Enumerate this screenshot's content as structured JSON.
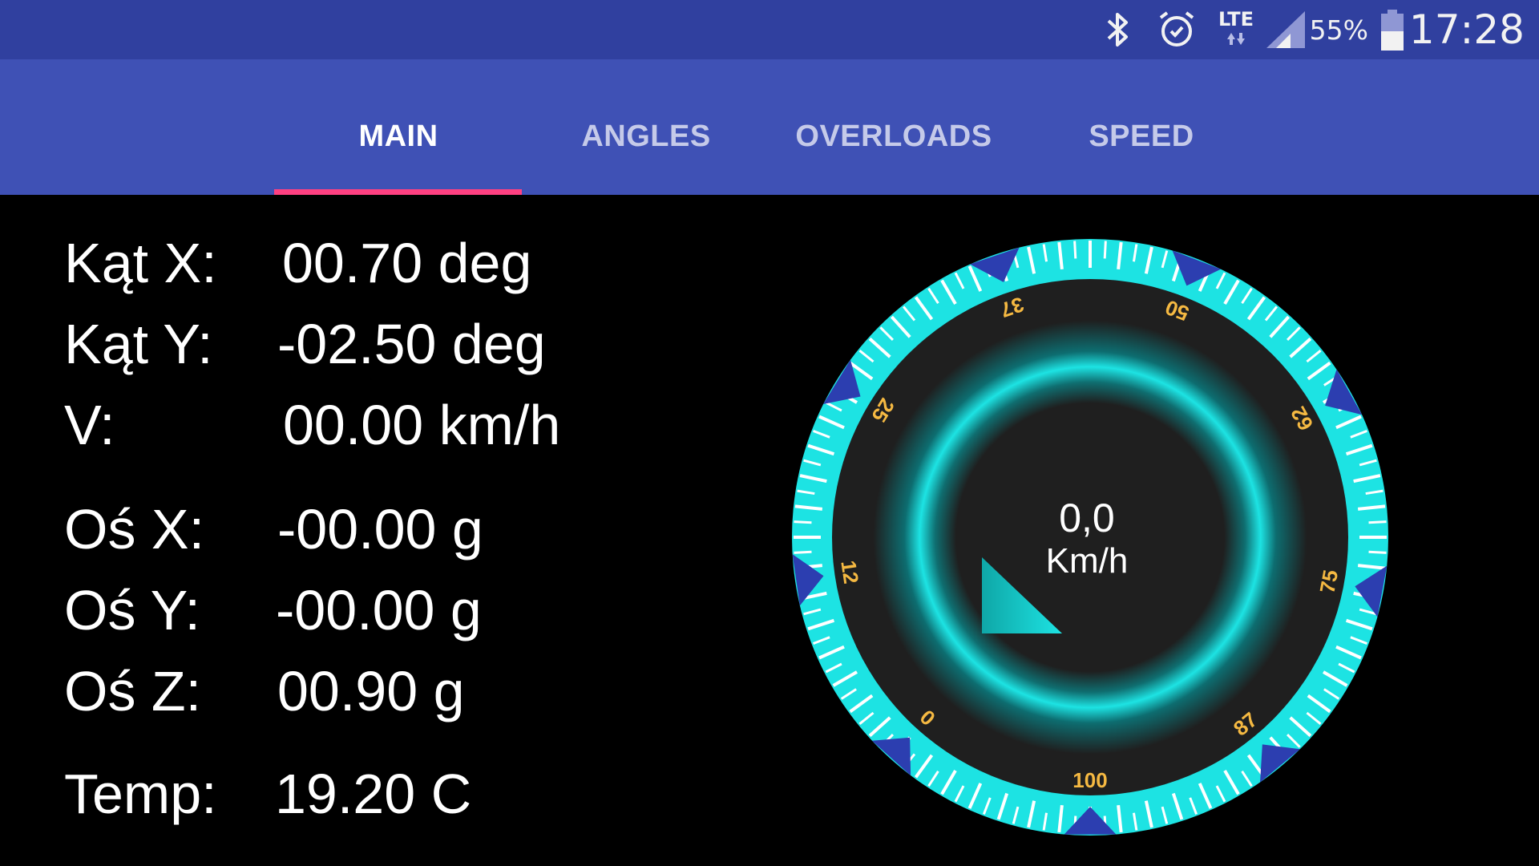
{
  "status_bar": {
    "time": "17:28",
    "battery_percent": "55%",
    "network": "LTE",
    "icons": [
      "bluetooth-icon",
      "alarm-icon",
      "lte-icon",
      "signal-icon",
      "battery-icon"
    ]
  },
  "tabs": [
    {
      "label": "MAIN",
      "active": true
    },
    {
      "label": "ANGLES",
      "active": false
    },
    {
      "label": "OVERLOADS",
      "active": false
    },
    {
      "label": "SPEED",
      "active": false
    }
  ],
  "readouts": {
    "kat_x": {
      "label": "Kąt X:",
      "value": "00.70  deg"
    },
    "kat_y": {
      "label": "Kąt Y:",
      "value": "-02.50  deg"
    },
    "v": {
      "label": "V:",
      "value": "00.00  km/h"
    },
    "os_x": {
      "label": "Oś X:",
      "value": "-00.00  g"
    },
    "os_y": {
      "label": "Oś Y:",
      "value": "-00.00  g"
    },
    "os_z": {
      "label": "Oś Z:",
      "value": "00.90  g"
    },
    "temp": {
      "label": "Temp:",
      "value": "19.20  C"
    }
  },
  "gauge": {
    "value_text": "0,0",
    "unit": "Km/h",
    "speed": 0,
    "scale_labels": [
      "0",
      "12",
      "25",
      "37",
      "50",
      "62",
      "75",
      "87",
      "100"
    ],
    "colors": {
      "ring": "#1de3e3",
      "background": "#1f1f1f",
      "labels": "#f5b942",
      "markers": "#2c3eb0"
    }
  },
  "colors": {
    "status_bar": "#30409f",
    "app_bar": "#3f51b5",
    "tab_indicator": "#ff4081"
  }
}
